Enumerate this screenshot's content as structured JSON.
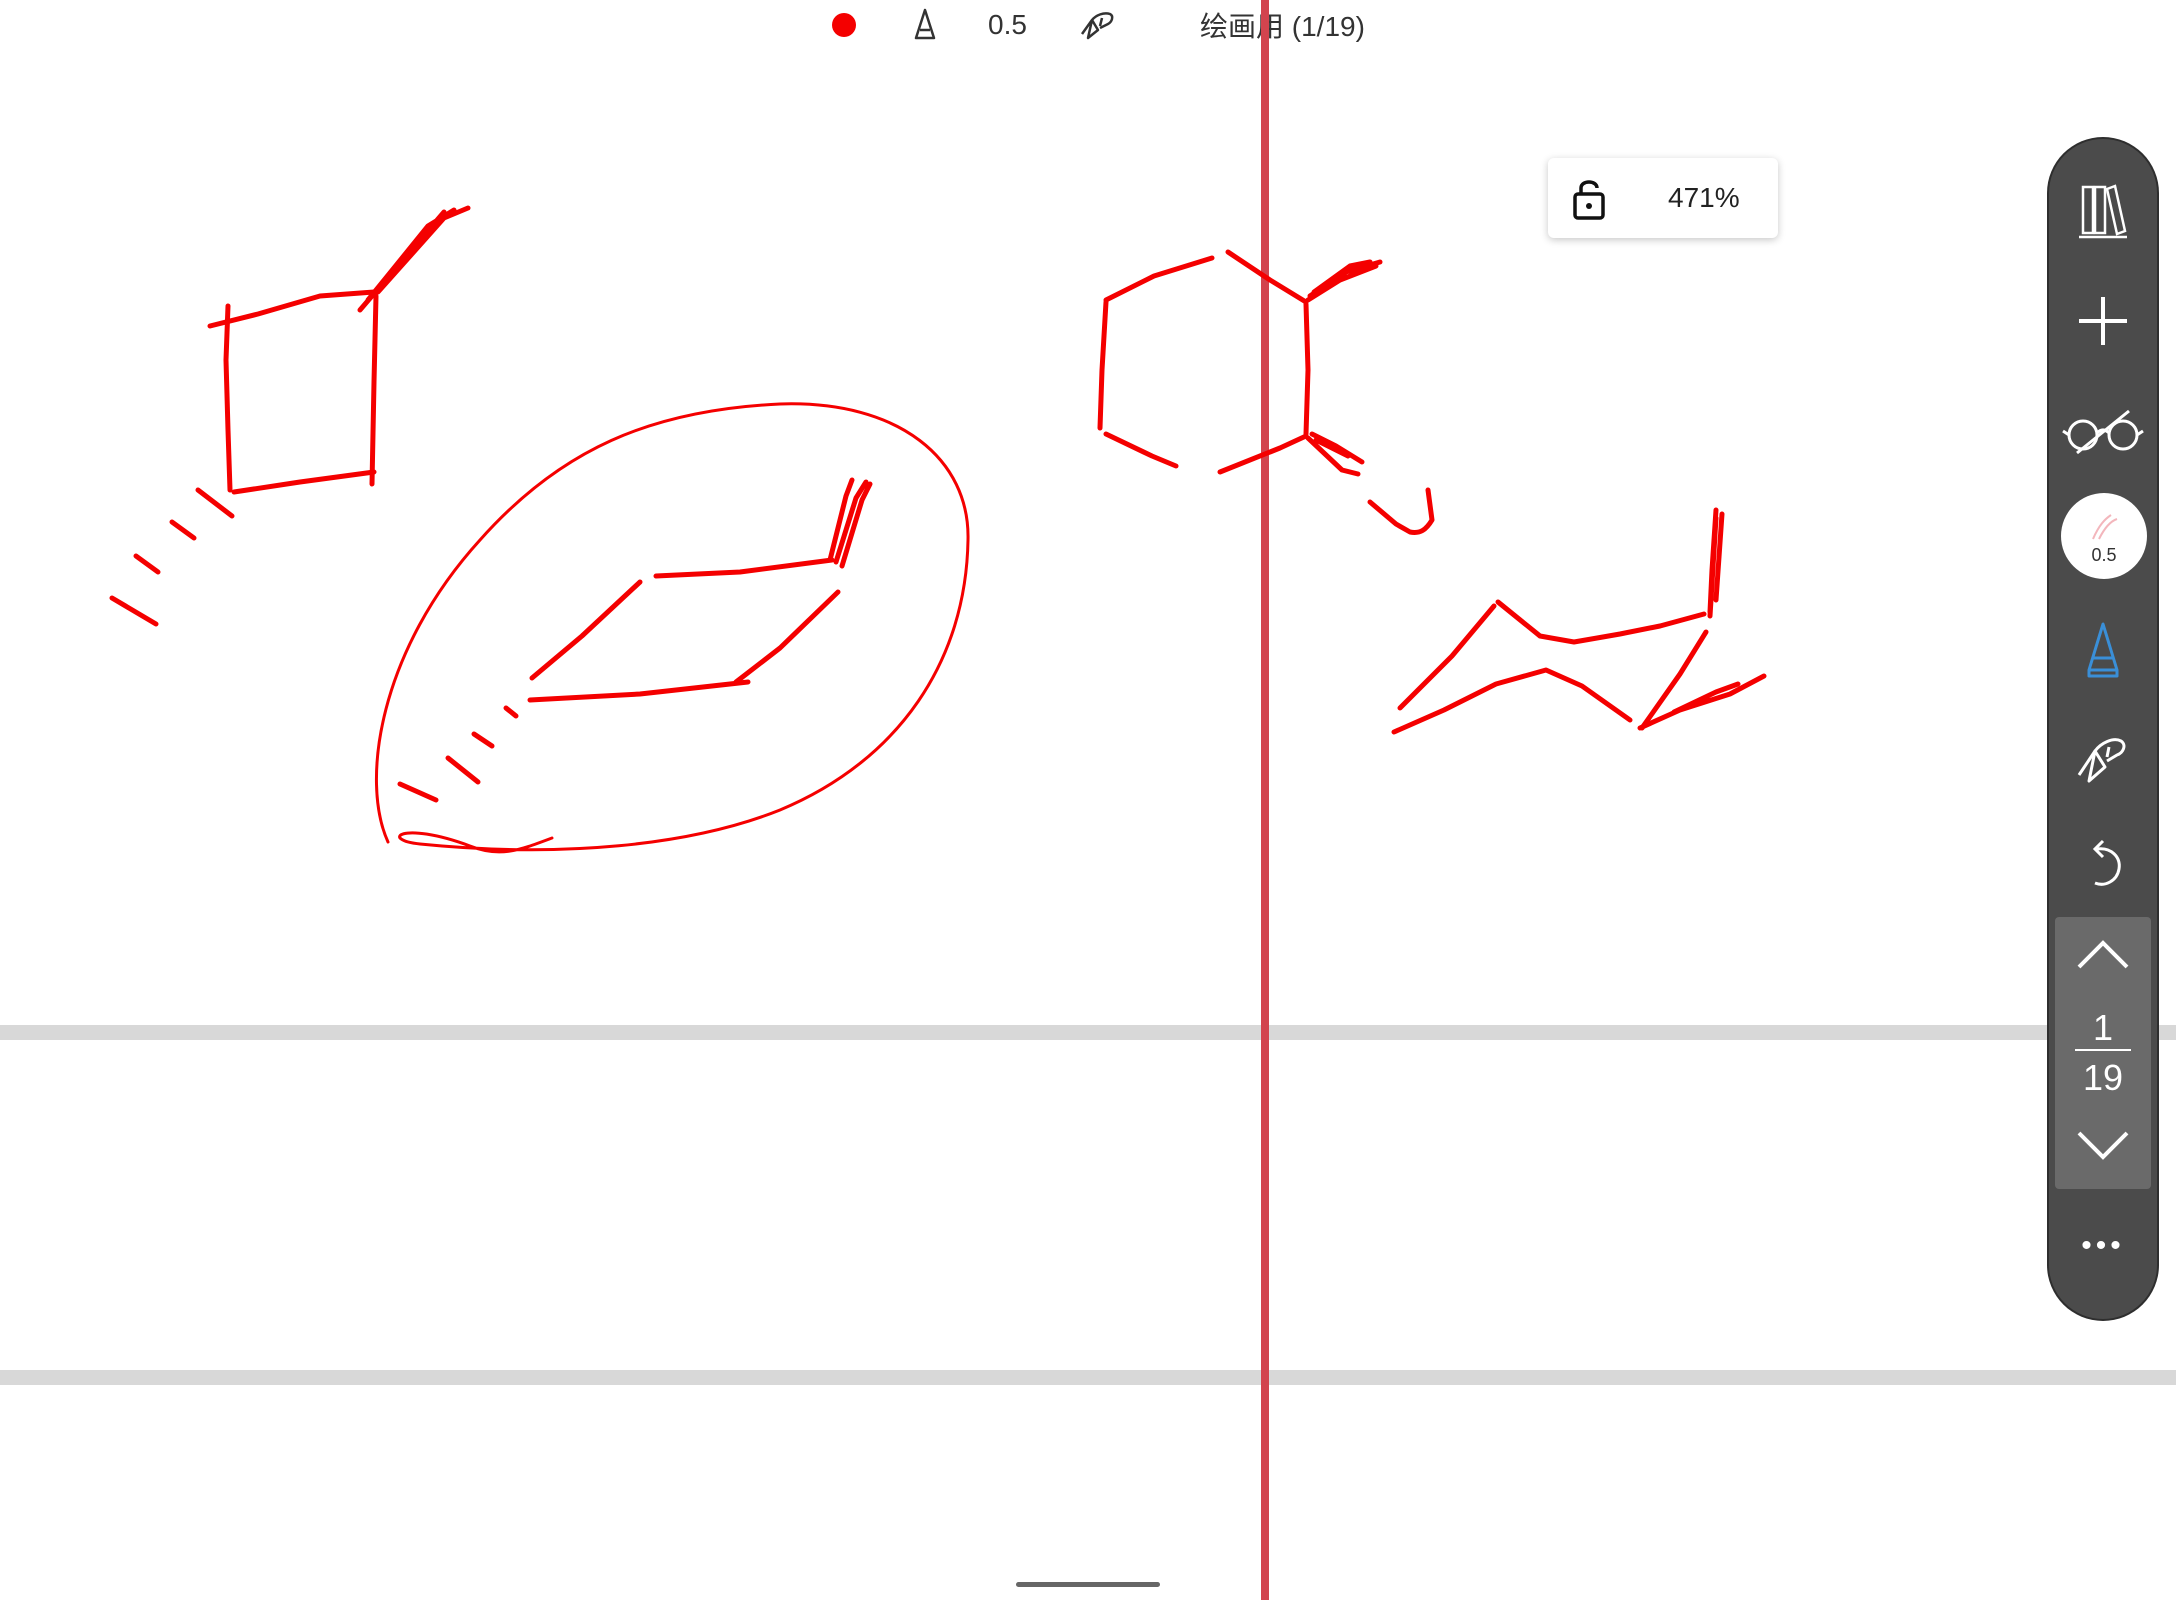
{
  "toolbar": {
    "pen_color": "#f40000",
    "pen_width": "0.5",
    "document_title": "绘画用 (1/19)"
  },
  "zoom": {
    "percent": "471%"
  },
  "side_panel": {
    "brush_size": "0.5",
    "current_page": "1",
    "total_pages": "19",
    "more_label": "•••"
  },
  "colors": {
    "ink": "#f40000",
    "panel": "#4b4b4b",
    "guide": "#d2444e",
    "accent": "#3a8fd8"
  }
}
